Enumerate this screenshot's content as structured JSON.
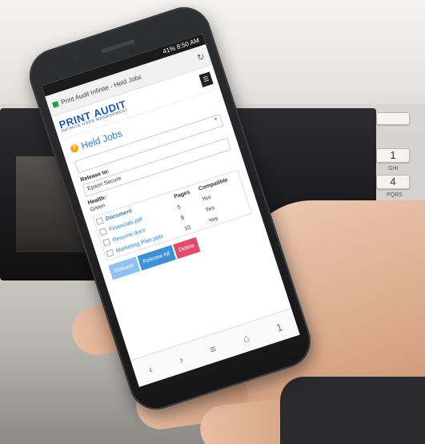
{
  "status_bar": {
    "text": "41% 8:50 AM"
  },
  "browser": {
    "tab_title": "Print Audit Infinite - Held Jobs"
  },
  "app": {
    "logo_main": "PRINT AUDIT",
    "logo_sub": "INFINITE USER MANAGEMENT"
  },
  "page": {
    "title": "Held Jobs",
    "release_to_label": "Release to:",
    "release_to_value": "Epson Secure",
    "health_label": "Health:",
    "health_value": "Green",
    "table": {
      "headers": [
        "Document",
        "Pages",
        "Compatible"
      ],
      "rows": [
        [
          "Financials.pdf",
          "5",
          "Yes"
        ],
        [
          "Resume.docx",
          "8",
          "Yes"
        ],
        [
          "Marketing Plan.pptx",
          "10",
          "Yes"
        ]
      ]
    },
    "buttons": {
      "release": "Release",
      "release_all": "Release All",
      "delete": "Delete"
    }
  },
  "nav_icons": [
    "back-icon",
    "forward-icon",
    "menu-icon",
    "home-icon",
    "tabs-icon"
  ],
  "tabs_count": "1",
  "printer_keys": [
    "1",
    "4"
  ],
  "printer_key_sub": "GHI",
  "printer_label": "PQRS",
  "colors": {
    "accent": "#2a7fc9",
    "delete": "#e04d6b",
    "release_all": "#3d8fd6",
    "logo": "#1f56a8"
  }
}
